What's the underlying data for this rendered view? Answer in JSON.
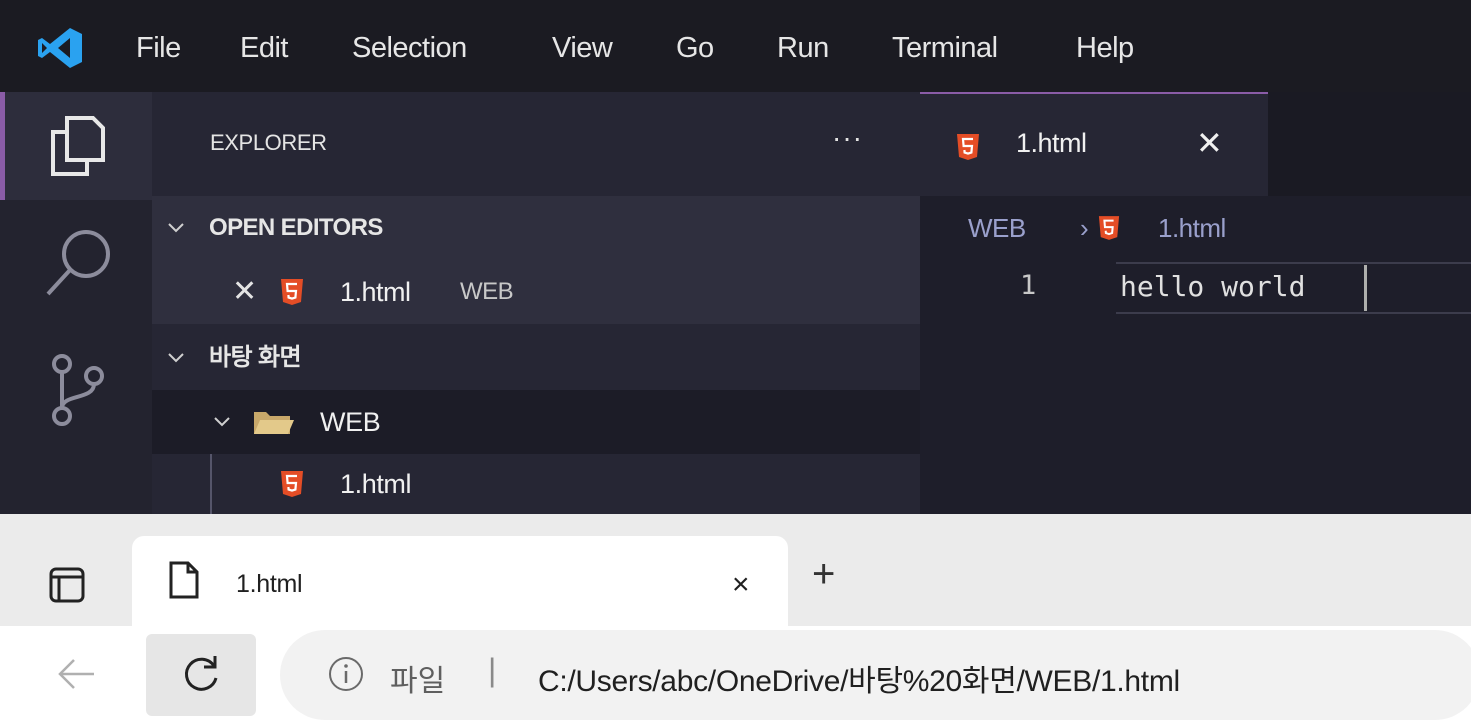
{
  "vscode": {
    "menu": [
      "File",
      "Edit",
      "Selection",
      "View",
      "Go",
      "Run",
      "Terminal",
      "Help"
    ],
    "explorer": {
      "title": "EXPLORER",
      "more": "···",
      "open_editors": {
        "label": "OPEN EDITORS",
        "items": [
          {
            "close": "✕",
            "name": "1.html",
            "description": "WEB"
          }
        ]
      },
      "workspace": {
        "label": "바탕 화면",
        "folder": "WEB",
        "file": "1.html"
      }
    },
    "editor": {
      "tab": {
        "label": "1.html",
        "close": "✕"
      },
      "breadcrumb": {
        "folder": "WEB",
        "separator": "›",
        "file": "1.html"
      },
      "lines": [
        {
          "number": "1",
          "text": "hello world"
        }
      ]
    },
    "colors": {
      "accent": "#8a5ca7",
      "html_icon": "#e44d26"
    }
  },
  "browser": {
    "tab": {
      "title": "1.html",
      "close": "×"
    },
    "new_tab": "+",
    "address": {
      "scheme": "파일",
      "separator": "|",
      "url": "C:/Users/abc/OneDrive/바탕%20화면/WEB/1.html"
    }
  }
}
